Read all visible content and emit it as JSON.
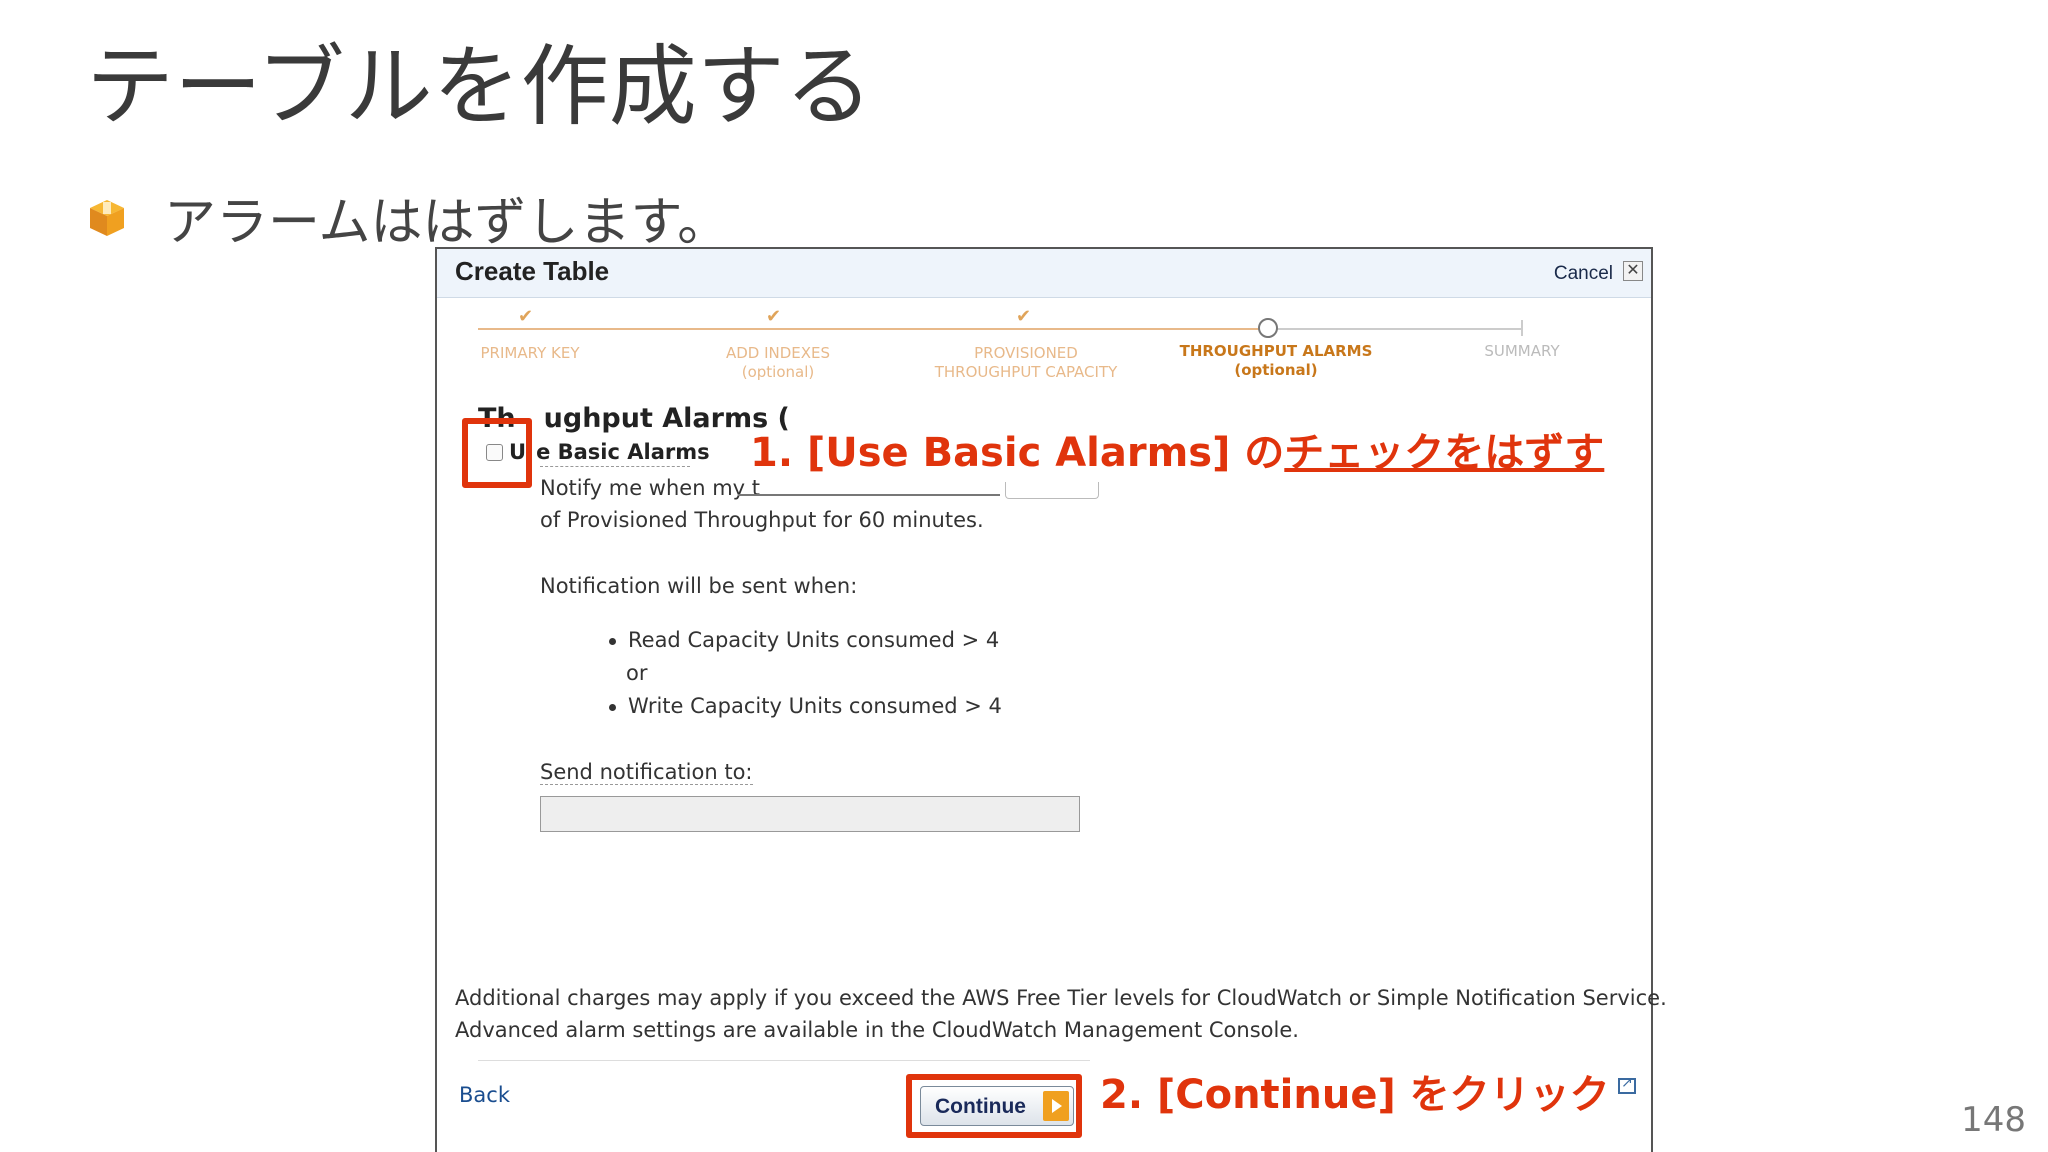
{
  "slide": {
    "title": "テーブルを作成する",
    "bullet": "アラームははずします。",
    "page_number": "148"
  },
  "dialog": {
    "title": "Create Table",
    "cancel_label": "Cancel",
    "close_symbol": "✕",
    "wizard_steps": [
      {
        "label": "PRIMARY KEY",
        "sublabel": "",
        "state": "done"
      },
      {
        "label": "ADD INDEXES",
        "sublabel": "(optional)",
        "state": "done"
      },
      {
        "label": "PROVISIONED",
        "sublabel": "THROUGHPUT CAPACITY",
        "state": "done"
      },
      {
        "label": "THROUGHPUT ALARMS",
        "sublabel": "(optional)",
        "state": "active"
      },
      {
        "label": "SUMMARY",
        "sublabel": "",
        "state": "future"
      }
    ],
    "section_heading_left": "Th",
    "section_heading_right": "ughput Alarms (",
    "checkbox_label_left": "U",
    "checkbox_label_right": "e Basic Alarms",
    "notify_text_start": "Notify me when my t",
    "notify_text_end": "of Provisioned Throughput for 60 minutes.",
    "notification_when": "Notification will be sent when:",
    "conditions": [
      "Read Capacity Units consumed > 4",
      "Write Capacity Units consumed > 4"
    ],
    "or_text": "or",
    "send_to_label": "Send notification to:",
    "email_value": "",
    "footer_line1": "Additional charges may apply if you exceed the AWS Free Tier levels for CloudWatch or Simple Notification Service.",
    "footer_line2": "Advanced alarm settings are available in the CloudWatch Management Console.",
    "back_label": "Back",
    "continue_label": "Continue"
  },
  "annotations": {
    "step1_prefix": "1. [Use Basic Alarms] の",
    "step1_underlined": "チェックをはずす",
    "step2": "2. [Continue] をクリック"
  },
  "colors": {
    "annotation_red": "#e0340c",
    "step_done": "#e8b98a",
    "step_active": "#c8771a",
    "header_bg": "#eef4fb"
  }
}
